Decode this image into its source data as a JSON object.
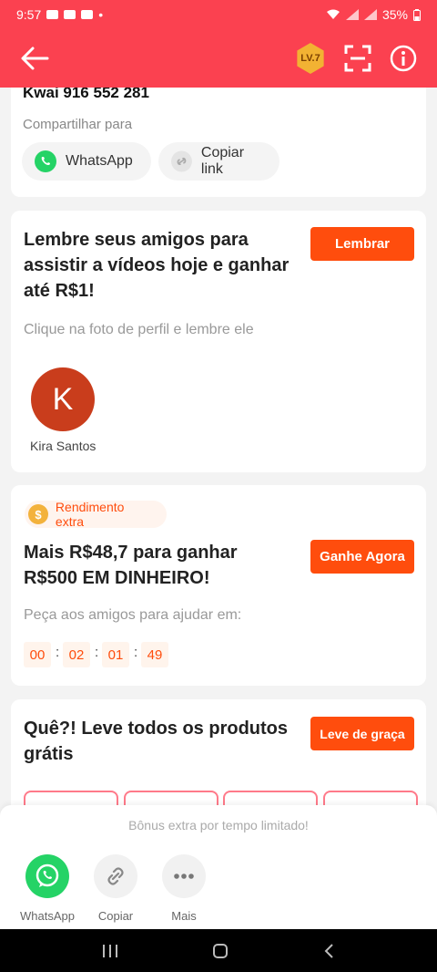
{
  "status_bar": {
    "time": "9:57",
    "dot": "•",
    "battery": "35%"
  },
  "app_bar": {
    "level": "LV.7"
  },
  "invite_card": {
    "kwai_id": "Kwai 916 552 281",
    "share_label": "Compartilhar para",
    "whatsapp_label": "WhatsApp",
    "copy_link_label": "Copiar link"
  },
  "remind_card": {
    "title": "Lembre seus amigos para assistir a vídeos hoje e ganhar até R$1!",
    "button": "Lembrar",
    "hint": "Clique na foto de perfil e lembre ele",
    "friend": {
      "initial": "K",
      "name": "Kira Santos"
    }
  },
  "extra_card": {
    "coin_symbol": "$",
    "badge": "Rendimento extra",
    "title": "Mais R$48,7 para ganhar R$500 EM DINHEIRO!",
    "button": "Ganhe Agora",
    "hint": "Peça aos amigos para ajudar em:",
    "timer": [
      "00",
      "02",
      "01",
      "49"
    ],
    "separator": ":"
  },
  "products_card": {
    "title": "Quê?! Leve todos os produtos grátis",
    "button": "Leve de graça"
  },
  "share_sheet": {
    "notice": "Bônus extra por tempo limitado!",
    "options": [
      {
        "label": "WhatsApp",
        "icon": "whatsapp-icon"
      },
      {
        "label": "Copiar",
        "icon": "link-icon"
      },
      {
        "label": "Mais",
        "icon": "more-icon"
      }
    ]
  },
  "colors": {
    "header": "#fb4150",
    "accent": "#ff4d0d",
    "whatsapp": "#25d366"
  }
}
